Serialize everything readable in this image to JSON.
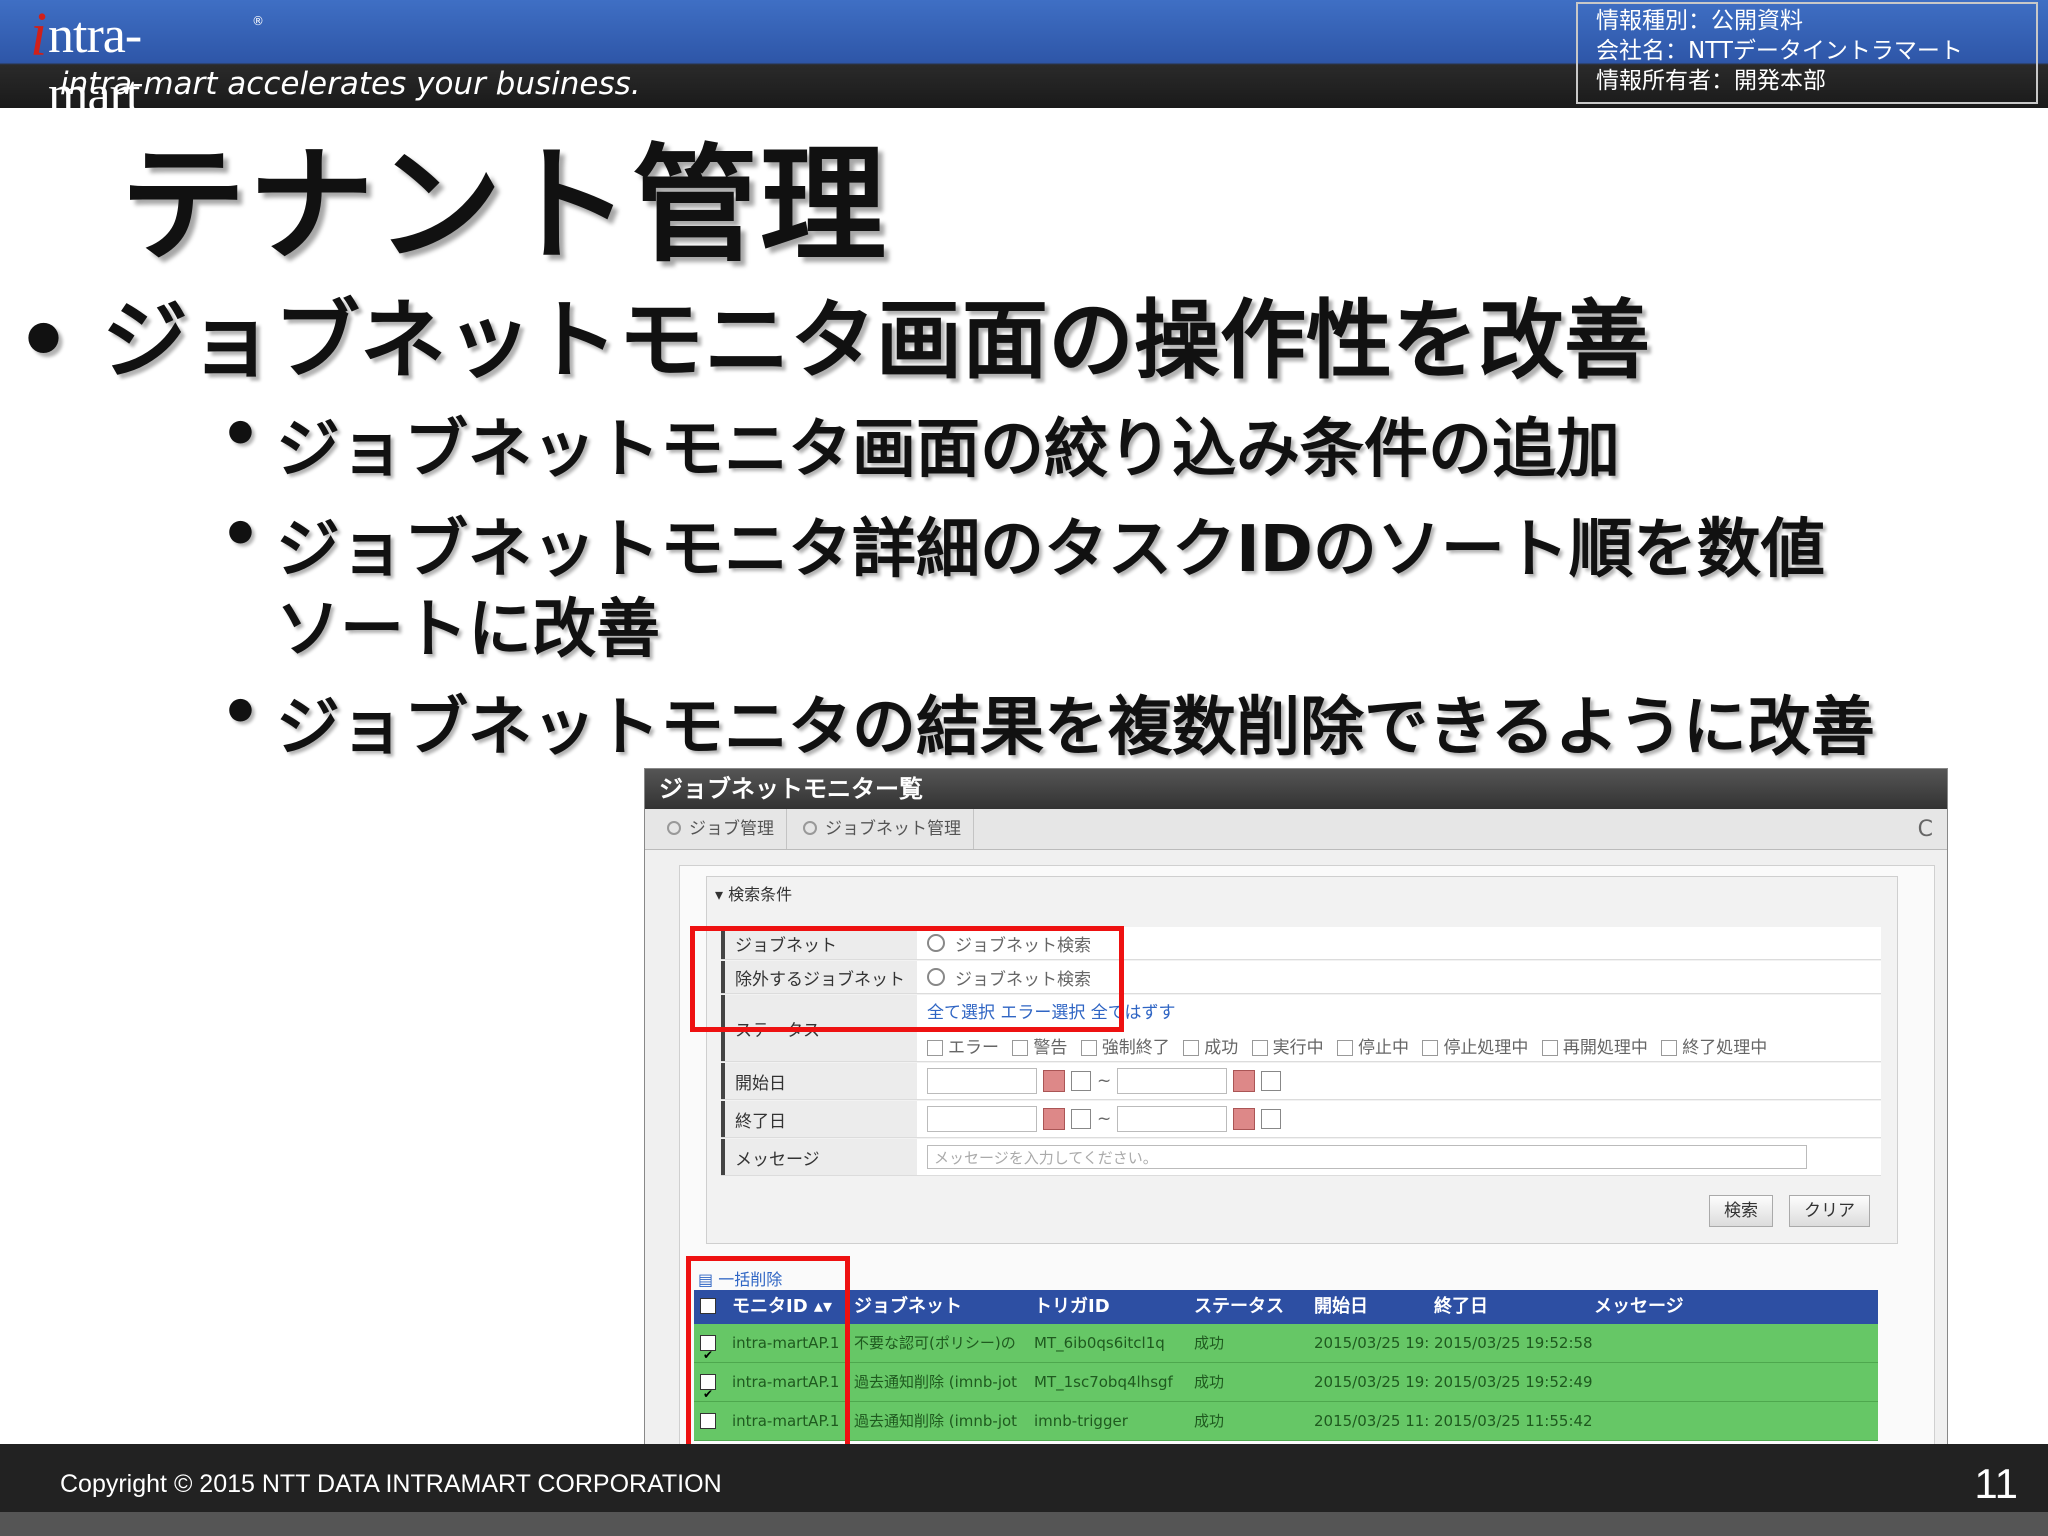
{
  "header": {
    "logo_text": "ntra-mart",
    "logo_initial": "i",
    "logo_mark": "®",
    "tagline": "intra-mart accelerates your business.",
    "info_lines": [
      "情報種別：公開資料",
      "会社名：NTTデータイントラマート",
      "情報所有者：開発本部"
    ]
  },
  "slide": {
    "title": "テナント管理",
    "bullet_dot": "•",
    "main_bullet": "ジョブネットモニタ画面の操作性を改善",
    "sub_bullets": [
      "ジョブネットモニタ画面の絞り込み条件の追加",
      "ジョブネットモニタ詳細のタスクIDのソート順を数値",
      "ソートに改善",
      "ジョブネットモニタの結果を複数削除できるように改善"
    ]
  },
  "screenshot": {
    "window_title": "ジョブネットモニター覧",
    "tabs": [
      "ジョブ管理",
      "ジョブネット管理"
    ],
    "refresh_glyph": "C",
    "legend": "▾ 検索条件",
    "fields": {
      "jobnet_label": "ジョブネット",
      "jobnet_value": "ジョブネット検索",
      "exclude_label": "除外するジョブネット",
      "exclude_value": "ジョブネット検索",
      "status_label": "ステータス",
      "status_links": "全て選択  エラー選択  全てはずす",
      "statuses": [
        "エラー",
        "警告",
        "強制終了",
        "成功",
        "実行中",
        "停止中",
        "停止処理中",
        "再開処理中",
        "終了処理中"
      ],
      "start_label": "開始日",
      "end_label": "終了日",
      "range_sep": "~",
      "message_label": "メッセージ",
      "message_placeholder": "メッセージを入力してください。"
    },
    "buttons": {
      "search": "検索",
      "clear": "クリア"
    },
    "bulk_delete": "一括削除",
    "columns": [
      "モニタID ▴▾",
      "ジョブネット",
      "トリガID",
      "ステータス",
      "開始日",
      "終了日",
      "メッセージ"
    ],
    "rows": [
      {
        "check": "✔",
        "id": "intra-martAP.1",
        "jobnet": "不要な認可(ポリシー)の",
        "trigger": "MT_6ib0qs6itcl1q",
        "status": "成功",
        "start": "2015/03/25 19:",
        "end": "2015/03/25 19:52:58"
      },
      {
        "check": "✔",
        "id": "intra-martAP.1",
        "jobnet": "過去通知削除 (imnb-jot",
        "trigger": "MT_1sc7obq4lhsgf",
        "status": "成功",
        "start": "2015/03/25 19:",
        "end": "2015/03/25 19:52:49"
      },
      {
        "check": "",
        "id": "intra-martAP.1",
        "jobnet": "過去通知削除 (imnb-jot",
        "trigger": "imnb-trigger",
        "status": "成功",
        "start": "2015/03/25 11:",
        "end": "2015/03/25 11:55:42"
      }
    ]
  },
  "footer": {
    "copyright": "Copyright © 2015 NTT DATA INTRAMART CORPORATION",
    "page_number": "11"
  },
  "colors": {
    "header_blue": "#3f6fc4",
    "logo_red": "#d0201a",
    "grid_header": "#2d4fa3",
    "row_green": "#66c766",
    "highlight_red": "#ee1111"
  }
}
